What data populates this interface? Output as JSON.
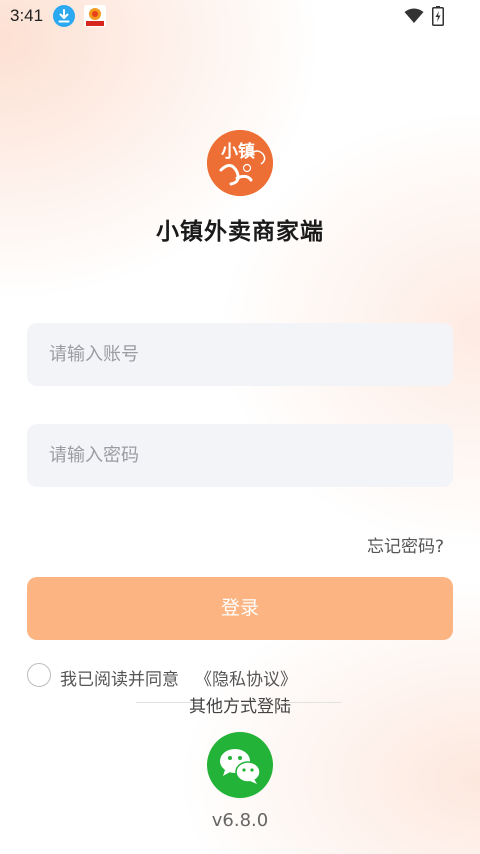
{
  "status_bar": {
    "time": "3:41",
    "icons": [
      "download-notification-icon",
      "app-notification-icon",
      "wifi-icon",
      "battery-charging-icon"
    ]
  },
  "logo": {
    "icon": "xiaozhen-logo-icon",
    "color": "#ee6f35",
    "text": "小镇"
  },
  "app_title": "小镇外卖商家端",
  "form": {
    "account_placeholder": "请输入账号",
    "account_value": "",
    "password_placeholder": "请输入密码",
    "password_value": "",
    "forgot_password": "忘记密码?",
    "login_label": "登录"
  },
  "agreement": {
    "checked": false,
    "text": "我已阅读并同意",
    "link": "《隐私协议》"
  },
  "other_login": {
    "label": "其他方式登陆",
    "wechat_icon": "wechat-icon"
  },
  "version": "v6.8.0",
  "colors": {
    "accent": "#fcb482",
    "logo": "#ee6f35",
    "wechat": "#23b338",
    "input_bg": "#f3f4f8"
  }
}
